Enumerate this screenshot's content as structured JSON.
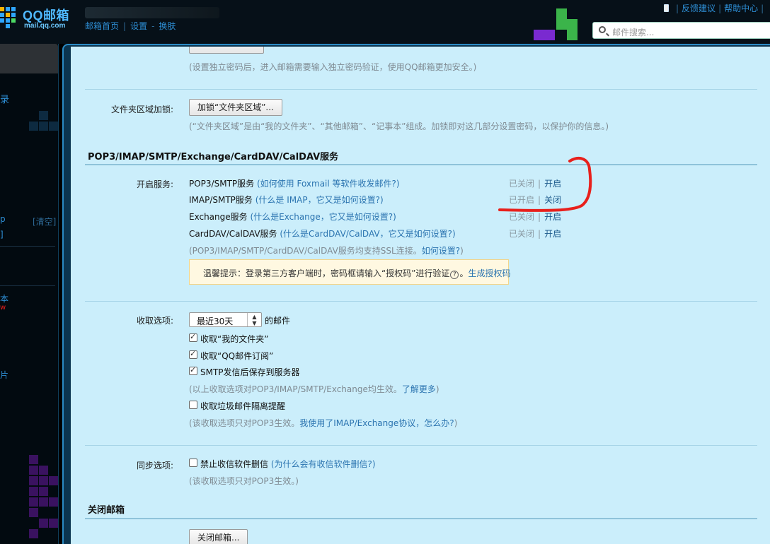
{
  "header": {
    "logo_text": "QQ邮箱",
    "logo_sub": "mail.qq.com",
    "nav": [
      "邮箱首页",
      "设置",
      "换肤"
    ],
    "top_links": [
      "反馈建议",
      "帮助中心"
    ],
    "search_placeholder": "邮件搜索..."
  },
  "sidebar": {
    "frag_login": "录",
    "frag_clear": "[清空]",
    "frag_a": "p",
    "frag_b": "]",
    "frag_c": "本",
    "frag_new": "w",
    "frag_card": "片"
  },
  "settings": {
    "password_hint": "(设置独立密码后，进入邮箱需要输入独立密码验证，使用QQ邮箱更加安全。)",
    "folder_lock": {
      "label": "文件夹区域加锁:",
      "button": "加锁“文件夹区域”...",
      "hint": "(“文件夹区域”是由“我的文件夹”、“其他邮箱”、“记事本”组成。加锁即对这几部分设置密码，以保护你的信息。)"
    },
    "pop3_section": {
      "title": "POP3/IMAP/SMTP/Exchange/CardDAV/CalDAV服务",
      "label": "开启服务:",
      "services": [
        {
          "name": "POP3/SMTP服务",
          "help": "(如何使用 Foxmail 等软件收发邮件?)",
          "status": "已关闭",
          "action": "开启"
        },
        {
          "name": "IMAP/SMTP服务",
          "help": "(什么是 IMAP，它又是如何设置?)",
          "status": "已开启",
          "action": "关闭"
        },
        {
          "name": "Exchange服务",
          "help": "(什么是Exchange，它又是如何设置?)",
          "status": "已关闭",
          "action": "开启"
        },
        {
          "name": "CardDAV/CalDAV服务",
          "help": "(什么是CardDAV/CalDAV，它又是如何设置?)",
          "status": "已关闭",
          "action": "开启"
        }
      ],
      "ssl_hint": "(POP3/IMAP/SMTP/CardDAV/CalDAV服务均支持SSL连接。",
      "ssl_link": "如何设置?",
      "ssl_close": ")",
      "tip_text": "温馨提示：登录第三方客户端时，密码框请输入“授权码”进行验证",
      "tip_q": "?",
      "tip_link": "生成授权码"
    },
    "receive": {
      "label": "收取选项:",
      "select_value": "最近30天",
      "select_suffix": "的邮件",
      "options": [
        {
          "label": "收取“我的文件夹”",
          "checked": true
        },
        {
          "label": "收取“QQ邮件订阅”",
          "checked": true
        },
        {
          "label": "SMTP发信后保存到服务器",
          "checked": true
        }
      ],
      "hint1": "(以上收取选项对POP3/IMAP/SMTP/Exchange均生效。",
      "hint1_link": "了解更多",
      "hint1_close": ")",
      "spam_label": "收取垃圾邮件隔离提醒",
      "hint2": "(该收取选项只对POP3生效。",
      "hint2_link": "我使用了IMAP/Exchange协议，怎么办?",
      "hint2_close": ")"
    },
    "sync": {
      "label": "同步选项:",
      "option": "禁止收信软件删信",
      "option_help": "(为什么会有收信软件删信?)",
      "hint": "(该收取选项只对POP3生效。)"
    },
    "close_section": {
      "title": "关闭邮箱",
      "button": "关闭邮箱..."
    }
  },
  "colors": {
    "panel_bg": "#cbeefb",
    "link": "#2b74b0",
    "annotation_red": "#e8201c"
  }
}
